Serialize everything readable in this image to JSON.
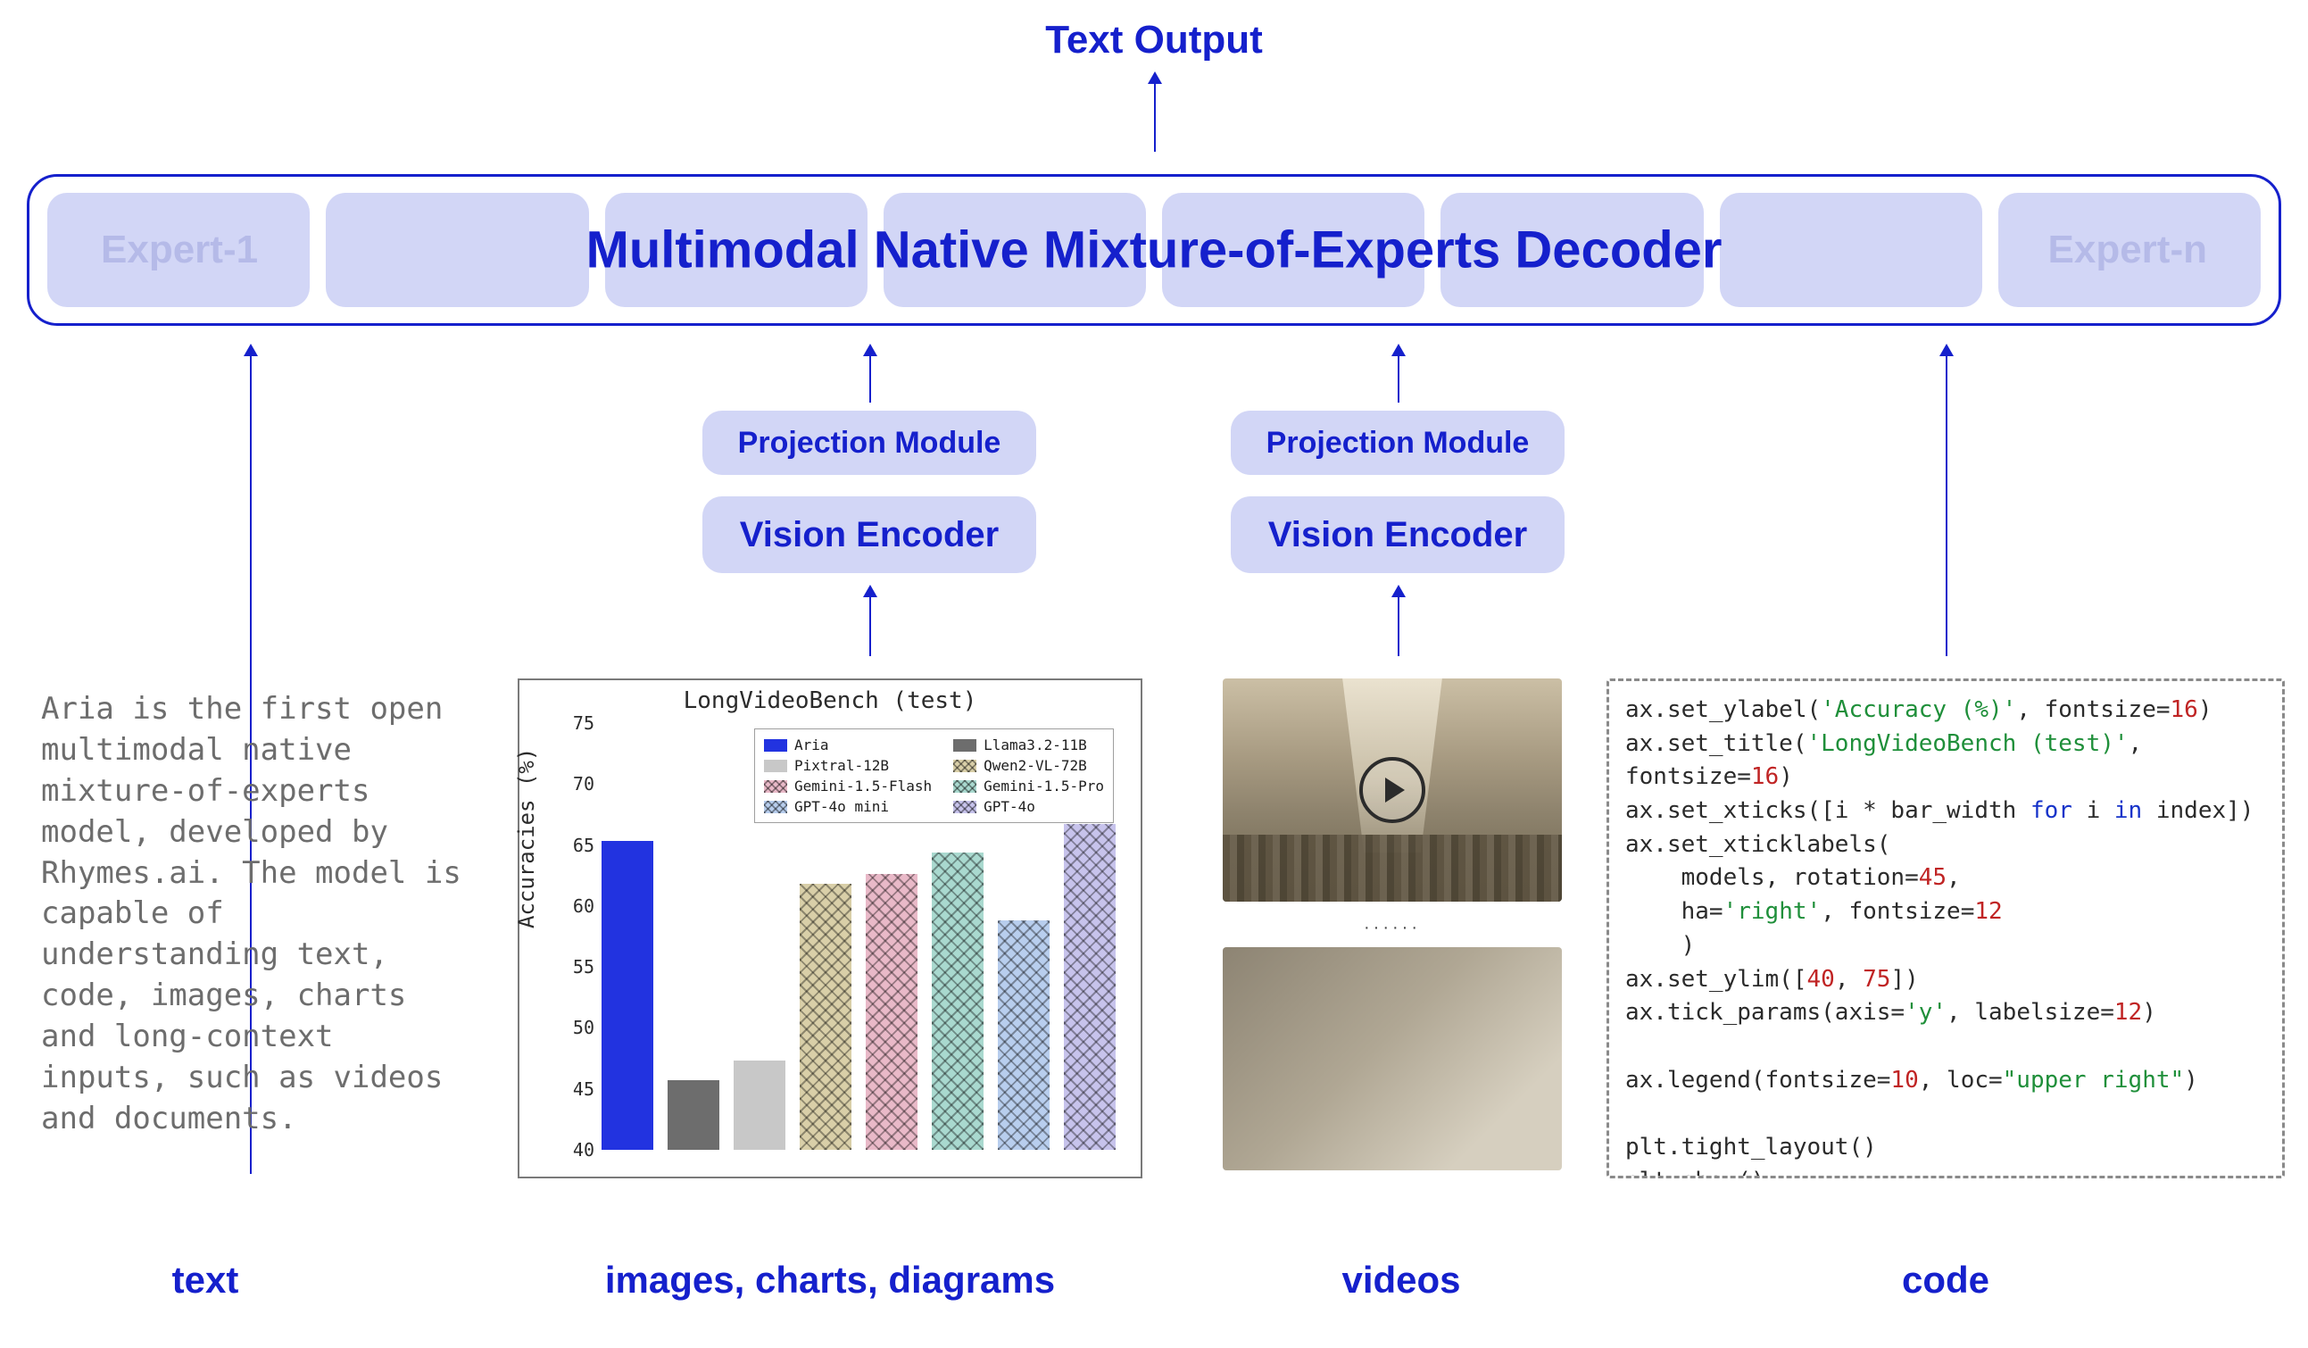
{
  "title": "Text Output",
  "decoder": {
    "title": "Multimodal Native Mixture-of-Experts Decoder",
    "expert_first": "Expert-1",
    "expert_last": "Expert-n"
  },
  "modules": {
    "projection": "Projection Module",
    "vision_encoder": "Vision Encoder"
  },
  "columns": {
    "text": "text",
    "images": "images, charts, diagrams",
    "videos": "videos",
    "code": "code"
  },
  "text_sample": "Aria is the first open multimodal native mixture-of-experts model, developed by Rhymes.ai. The model is capable of understanding text, code, images, charts and long-context inputs, such as videos and documents.",
  "video": {
    "ellipsis": "······"
  },
  "code_tokens": [
    {
      "t": "ax.set_ylabel("
    },
    {
      "t": "'Accuracy (%)'",
      "c": "str"
    },
    {
      "t": ", fontsize="
    },
    {
      "t": "16",
      "c": "num"
    },
    {
      "t": ")\n"
    },
    {
      "t": "ax.set_title("
    },
    {
      "t": "'LongVideoBench (test)'",
      "c": "str"
    },
    {
      "t": ", fontsize="
    },
    {
      "t": "16",
      "c": "num"
    },
    {
      "t": ")\n"
    },
    {
      "t": "ax.set_xticks([i * bar_width "
    },
    {
      "t": "for",
      "c": "kw"
    },
    {
      "t": " i "
    },
    {
      "t": "in",
      "c": "kw"
    },
    {
      "t": " index])\n"
    },
    {
      "t": "ax.set_xticklabels(\n    models, rotation="
    },
    {
      "t": "45",
      "c": "num"
    },
    {
      "t": ",\n    ha="
    },
    {
      "t": "'right'",
      "c": "str"
    },
    {
      "t": ", fontsize="
    },
    {
      "t": "12",
      "c": "num"
    },
    {
      "t": "\n    )\n"
    },
    {
      "t": "ax.set_ylim(["
    },
    {
      "t": "40",
      "c": "num"
    },
    {
      "t": ", "
    },
    {
      "t": "75",
      "c": "num"
    },
    {
      "t": "])\n"
    },
    {
      "t": "ax.tick_params(axis="
    },
    {
      "t": "'y'",
      "c": "str"
    },
    {
      "t": ", labelsize="
    },
    {
      "t": "12",
      "c": "num"
    },
    {
      "t": ")\n\n"
    },
    {
      "t": "ax.legend(fontsize="
    },
    {
      "t": "10",
      "c": "num"
    },
    {
      "t": ", loc="
    },
    {
      "t": "\"upper right\"",
      "c": "str"
    },
    {
      "t": ")\n\n"
    },
    {
      "t": "plt.tight_layout()\nplt.show()"
    }
  ],
  "chart_data": {
    "type": "bar",
    "title": "LongVideoBench (test)",
    "ylabel": "Accuracies (%)",
    "ylim": [
      40,
      75
    ],
    "yticks": [
      40,
      45,
      50,
      55,
      60,
      65,
      70,
      75
    ],
    "series": [
      {
        "name": "Aria",
        "value": 65.3,
        "color": "#2233e0",
        "hatch": "none"
      },
      {
        "name": "Llama3.2-11B",
        "value": 45.7,
        "color": "#6d6d6d",
        "hatch": "none"
      },
      {
        "name": "Pixtral-12B",
        "value": 47.3,
        "color": "#c8c8c8",
        "hatch": "none"
      },
      {
        "name": "Qwen2-VL-72B",
        "value": 61.8,
        "color": "#d9cfa8",
        "hatch": "cross"
      },
      {
        "name": "Gemini-1.5-Flash",
        "value": 62.6,
        "color": "#e9b9c8",
        "hatch": "cross"
      },
      {
        "name": "Gemini-1.5-Pro",
        "value": 64.4,
        "color": "#a9d9cf",
        "hatch": "cross"
      },
      {
        "name": "GPT-4o mini",
        "value": 58.8,
        "color": "#b8ceee",
        "hatch": "cross"
      },
      {
        "name": "GPT-4o",
        "value": 66.7,
        "color": "#c7c3ec",
        "hatch": "cross"
      }
    ]
  }
}
